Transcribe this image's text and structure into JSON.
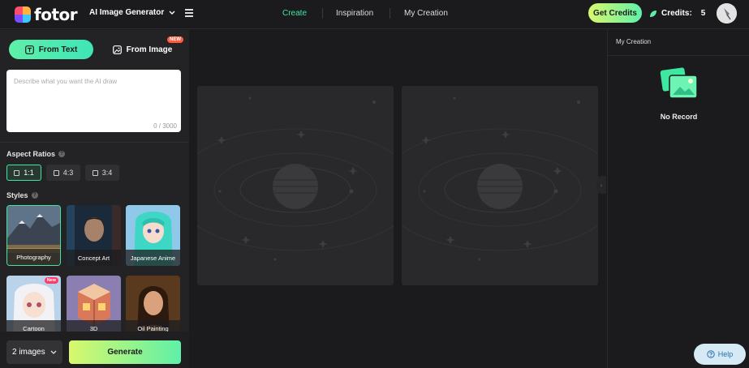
{
  "header": {
    "logo_text": "fotor",
    "product_menu": "AI Image Generator",
    "nav": [
      "Create",
      "Inspiration",
      "My Creation"
    ],
    "active_nav": "Create",
    "get_credits": "Get Credits",
    "credits_label": "Credits:",
    "credits_value": "5",
    "accent_color": "#3ee8a0"
  },
  "left_panel": {
    "tabs": {
      "from_text": "From Text",
      "from_image": "From Image",
      "new_badge": "NEW"
    },
    "prompt": {
      "placeholder": "Describe what you want the AI draw",
      "value": "",
      "char_count": "0 / 3000"
    },
    "aspect_ratios": {
      "label": "Aspect Ratios",
      "help": "?",
      "options": [
        "1:1",
        "4:3",
        "3:4"
      ],
      "selected": "1:1"
    },
    "styles": {
      "label": "Styles",
      "help": "?",
      "items": [
        {
          "label": "Photography",
          "selected": true
        },
        {
          "label": "Concept Art",
          "selected": false
        },
        {
          "label": "Japanese Anime",
          "selected": false
        },
        {
          "label": "Cartoon",
          "selected": false,
          "badge": "New"
        },
        {
          "label": "3D",
          "selected": false
        },
        {
          "label": "Oil Painting",
          "selected": false
        }
      ]
    },
    "image_count": "2 images",
    "generate": "Generate"
  },
  "right_panel": {
    "title": "My Creation",
    "empty_text": "No Record"
  },
  "help_button": "Help",
  "icons": {
    "menu": "hamburger-icon",
    "dropdown": "chevron-down-icon",
    "text_tab": "text-icon",
    "image_tab": "image-icon",
    "credits": "leaf-icon",
    "empty": "image-stack-icon",
    "help": "question-circle-icon",
    "collapse": "chevron-right-icon"
  }
}
